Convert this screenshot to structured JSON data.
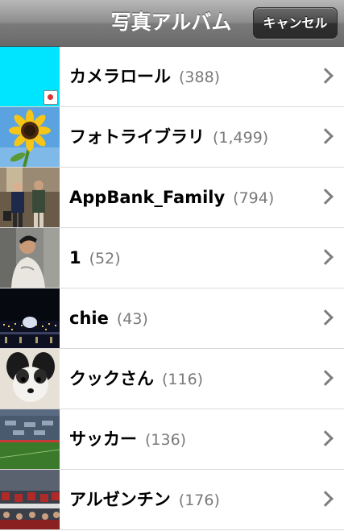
{
  "navbar": {
    "title": "写真アルバム",
    "cancel_label": "キャンセル"
  },
  "albums": [
    {
      "name": "カメラロール",
      "count": "(388)",
      "thumb_icon": "camera-roll-thumbnail"
    },
    {
      "name": "フォトライブラリ",
      "count": "(1,499)",
      "thumb_icon": "sunflower-thumbnail"
    },
    {
      "name": "AppBank_Family",
      "count": "(794)",
      "thumb_icon": "group-photo-thumbnail"
    },
    {
      "name": "1",
      "count": "(52)",
      "thumb_icon": "person-photo-thumbnail"
    },
    {
      "name": "chie",
      "count": "(43)",
      "thumb_icon": "night-city-thumbnail"
    },
    {
      "name": "クックさん",
      "count": "(116)",
      "thumb_icon": "puppy-thumbnail"
    },
    {
      "name": "サッカー",
      "count": "(136)",
      "thumb_icon": "stadium-thumbnail"
    },
    {
      "name": "アルゼンチン",
      "count": "(176)",
      "thumb_icon": "crowd-thumbnail"
    }
  ],
  "colors": {
    "camera_roll_thumb": "#00e5ff",
    "count_text": "#7a7a7a",
    "chevron": "#7d7d7d"
  }
}
